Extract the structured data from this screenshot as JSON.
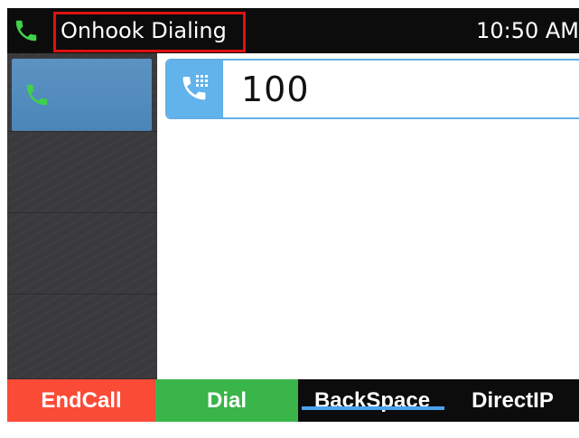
{
  "status_bar": {
    "title": "Onhook Dialing",
    "time": "10:50 AM",
    "call_icon": "phone-handset-icon"
  },
  "sidebar": {
    "lines": [
      {
        "icon": "phone-handset-icon",
        "active": true
      },
      {
        "icon": "",
        "active": false
      },
      {
        "icon": "",
        "active": false
      },
      {
        "icon": "",
        "active": false
      }
    ]
  },
  "dial_input": {
    "icon": "dialpad-phone-icon",
    "value": "100"
  },
  "softkeys": [
    {
      "label": "EndCall",
      "color": "#fa4b37"
    },
    {
      "label": "Dial",
      "color": "#39b54a"
    },
    {
      "label": "BackSpace",
      "color": "#0c0c0c",
      "selected": true
    },
    {
      "label": "DirectIP",
      "color": "#0c0c0c"
    }
  ],
  "colors": {
    "status_bar_bg": "#0c0c0c",
    "accent": "#4aa3f0",
    "highlight_box": "#e01010",
    "phone_icon_green": "#3fd14a"
  }
}
